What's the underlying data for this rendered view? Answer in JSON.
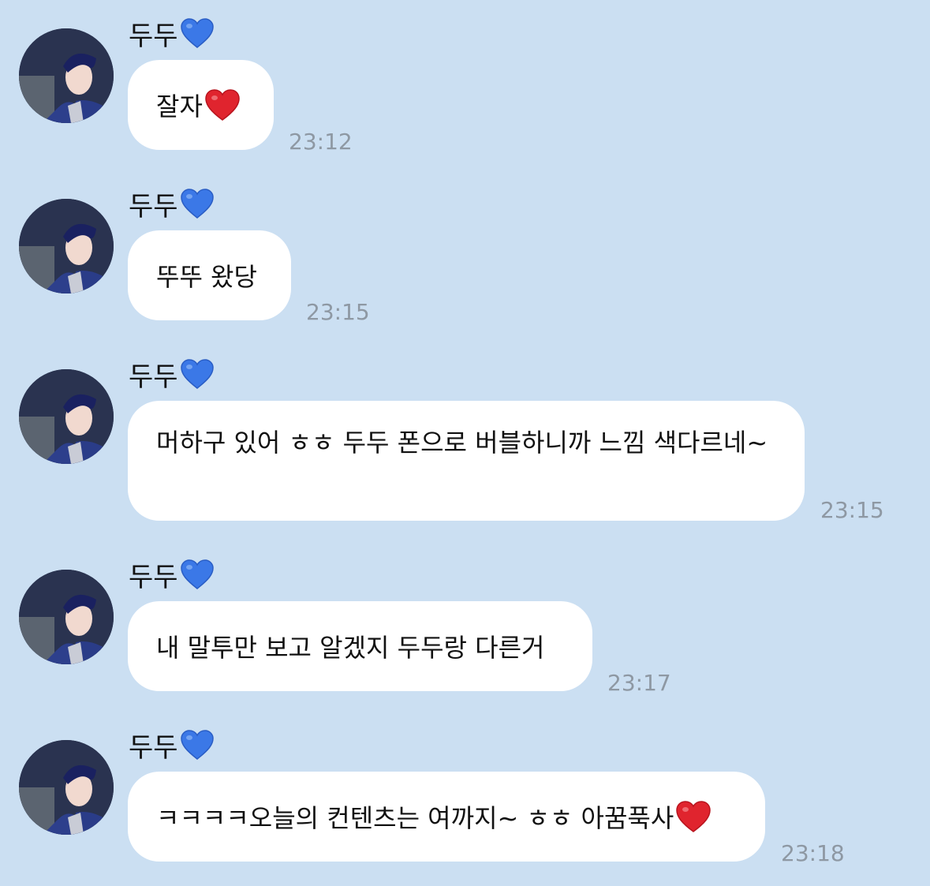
{
  "chat": {
    "messages": [
      {
        "sender": "두두",
        "text": "잘자",
        "heart": true,
        "time": "23:12"
      },
      {
        "sender": "두두",
        "text": "뚜뚜 왔당",
        "heart": false,
        "time": "23:15"
      },
      {
        "sender": "두두",
        "text": "머하구 있어 ㅎㅎ 두두 폰으로 버블하니까 느낌 색다르네~",
        "heart": false,
        "time": "23:15"
      },
      {
        "sender": "두두",
        "text": "내 말투만 보고 알겠지 두두랑 다른거",
        "heart": false,
        "time": "23:17"
      },
      {
        "sender": "두두",
        "text": "ㅋㅋㅋㅋ오늘의 컨텐츠는 여까지~ ㅎㅎ 아꿈푹사",
        "heart": true,
        "time": "23:18"
      }
    ]
  },
  "icons": {
    "name_suffix": "blue-heart-icon",
    "message_heart": "red-heart-icon"
  },
  "colors": {
    "background": "#cbdff2",
    "bubble": "#ffffff",
    "timestamp": "#8e98a3",
    "blue_heart": "#3b78e7",
    "red_heart": "#e0242e"
  }
}
